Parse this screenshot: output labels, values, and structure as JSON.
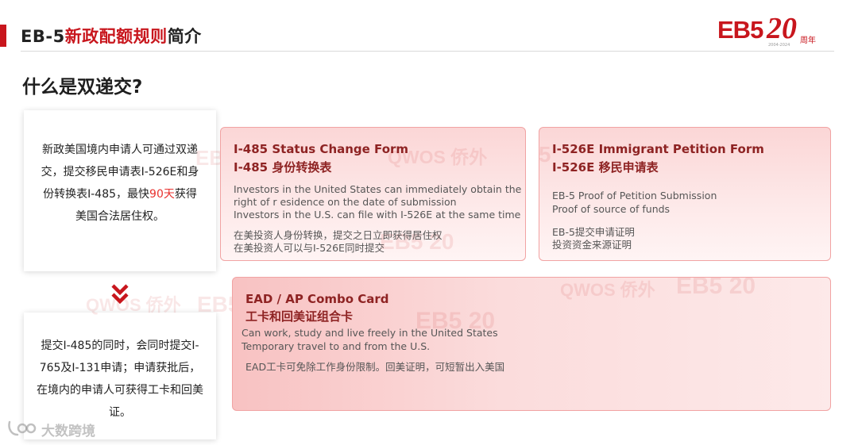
{
  "header": {
    "title_part1": "EB-5",
    "title_part2": "新政配额规则",
    "title_part3": "简介"
  },
  "logo": {
    "brand": "EB5",
    "anniversary": "20",
    "suffix": "周年",
    "years": "2004-2024"
  },
  "question": "什么是双递交?",
  "left_top": {
    "text_before": "新政美国境内申请人可通过双递交，提交移民申请表I-526E和身份转换表I-485，最快",
    "highlight": "90天",
    "text_after": "获得美国合法居住权。"
  },
  "left_bottom": {
    "text": "提交I-485的同时，会同时提交I-765及I-131申请；申请获批后，在境内的申请人可获得工卡和回美证。"
  },
  "cards": [
    {
      "title_en": "I-485 Status Change Form",
      "title_zh": "I-485 身份转换表",
      "en_lines": [
        "Investors in the United States can immediately obtain the",
        "right of r esidence on the date of submission",
        "Investors in the U.S. can file with I-526E at the same time"
      ],
      "zh_lines": [
        "在美投资人身份转换，提交之日立即获得居住权",
        "在美投资人可以与I-526E同时提交"
      ]
    },
    {
      "title_en": "I-526E Immigrant Petition Form",
      "title_zh": "I-526E 移民申请表",
      "en_lines": [
        "EB-5 Proof of Petition Submission",
        "Proof of source of funds"
      ],
      "zh_lines": [
        "EB-5提交申请证明",
        "投资资金来源证明"
      ]
    },
    {
      "title_en": "EAD / AP Combo Card",
      "title_zh": "工卡和回美证组合卡",
      "en_lines": [
        "Can work, study and live freely in the United States",
        "Temporary travel to and from the U.S."
      ],
      "zh_lines": [
        "EAD工卡可免除工作身份限制。回美证明，可短暂出入美国"
      ]
    }
  ],
  "watermarks": {
    "qwos": "QWOS 侨外",
    "eb5": "EB5",
    "eb5_20": "EB5 20"
  },
  "footer_logo": "大数跨境",
  "colors": {
    "brand_red": "#c8161d",
    "highlight_red": "#e8322f",
    "card_title": "#8e2323"
  }
}
